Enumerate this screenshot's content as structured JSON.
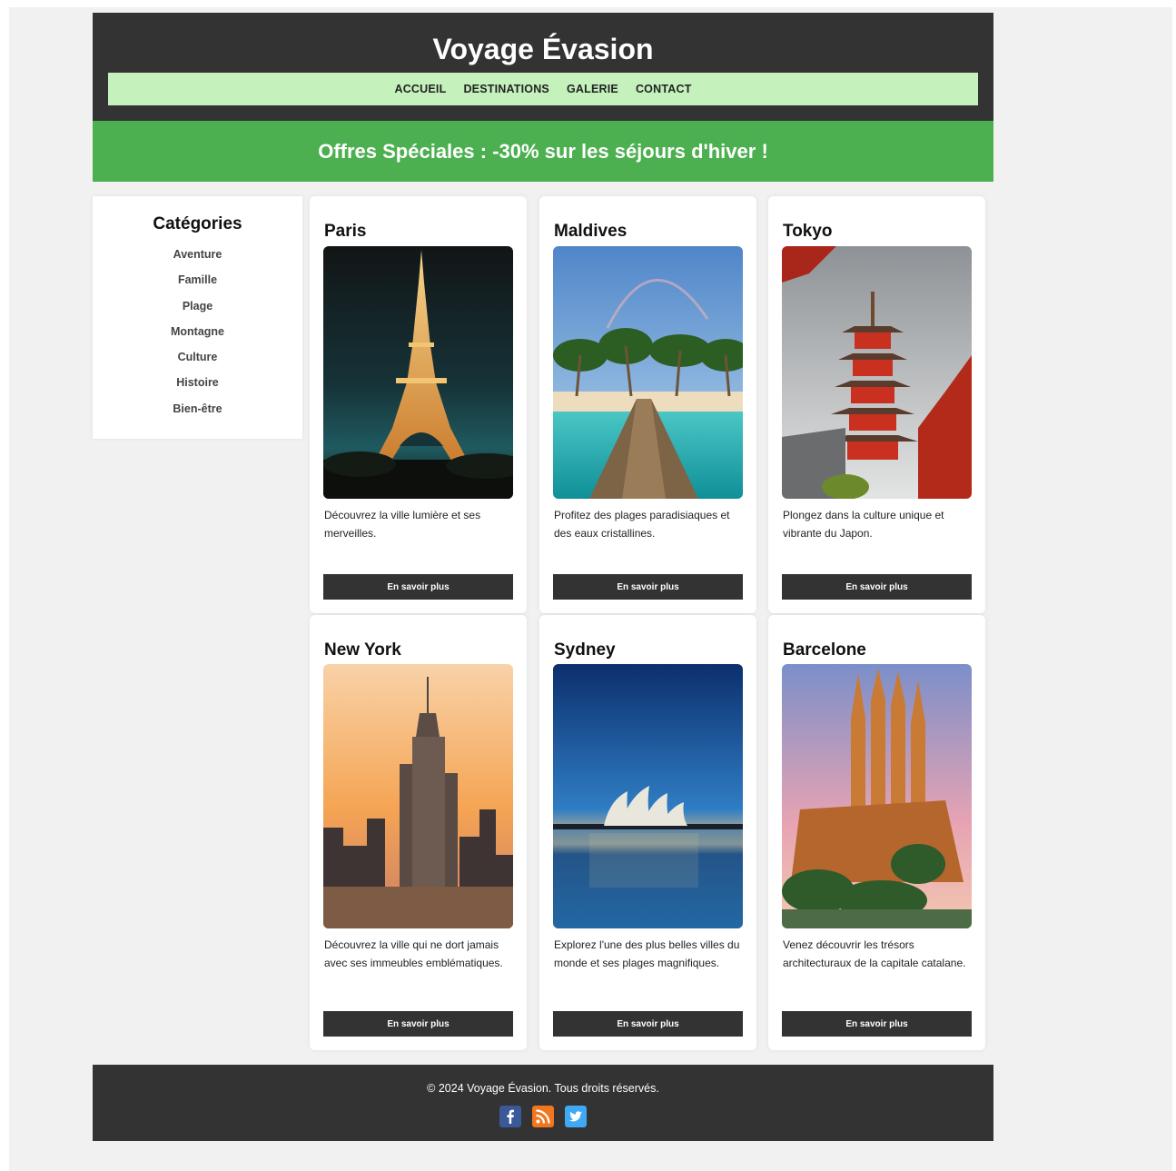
{
  "site": {
    "title": "Voyage Évasion"
  },
  "nav": {
    "items": [
      "ACCUEIL",
      "DESTINATIONS",
      "GALERIE",
      "CONTACT"
    ]
  },
  "promo": {
    "text": "Offres Spéciales : -30% sur les séjours d'hiver !"
  },
  "sidebar": {
    "title": "Catégories",
    "categories": [
      "Aventure",
      "Famille",
      "Plage",
      "Montagne",
      "Culture",
      "Histoire",
      "Bien-être"
    ]
  },
  "cards": [
    {
      "title": "Paris",
      "description": "Découvrez la ville lumière et ses merveilles.",
      "button": "En savoir plus",
      "image": "eiffel-tower-night"
    },
    {
      "title": "Maldives",
      "description": "Profitez des plages paradisiaques et des eaux cristallines.",
      "button": "En savoir plus",
      "image": "tropical-beach-pier"
    },
    {
      "title": "Tokyo",
      "description": "Plongez dans la culture unique et vibrante du Japon.",
      "button": "En savoir plus",
      "image": "red-pagoda-temple"
    },
    {
      "title": "New York",
      "description": "Découvrez la ville qui ne dort jamais avec ses immeubles emblématiques.",
      "button": "En savoir plus",
      "image": "skyline-sunset"
    },
    {
      "title": "Sydney",
      "description": "Explorez l'une des plus belles villes du monde et ses plages magnifiques.",
      "button": "En savoir plus",
      "image": "opera-house-dusk"
    },
    {
      "title": "Barcelone",
      "description": "Venez découvrir les trésors architecturaux de la capitale catalane.",
      "button": "En savoir plus",
      "image": "sagrada-familia"
    }
  ],
  "footer": {
    "copyright": "© 2024 Voyage Évasion. Tous droits réservés.",
    "social": [
      "facebook-icon",
      "rss-icon",
      "twitter-icon"
    ]
  },
  "colors": {
    "header_bg": "#333333",
    "nav_bg": "#c4f1bc",
    "promo_bg": "#4caf50",
    "button_bg": "#333333",
    "page_bg": "#f1f1f1"
  }
}
